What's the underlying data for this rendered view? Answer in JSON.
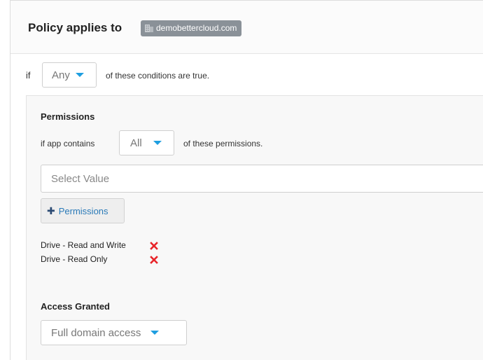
{
  "policy": {
    "title": "Policy applies to",
    "domain": "demobettercloud.com",
    "domain_icon": "building-icon"
  },
  "conditions": {
    "if_label": "if",
    "match": "Any",
    "suffix": "of these conditions are true."
  },
  "permissions_section": {
    "title": "Permissions",
    "prefix": "if app contains",
    "match": "All",
    "suffix": "of these permissions.",
    "select_placeholder": "Select Value",
    "add_button_label": "Permissions",
    "add_button_icon": "plus-icon",
    "items": [
      {
        "label": "Drive - Read and Write",
        "remove_icon": "remove-x-icon"
      },
      {
        "label": "Drive - Read Only",
        "remove_icon": "remove-x-icon"
      }
    ]
  },
  "access_section": {
    "title": "Access Granted",
    "value": "Full domain access"
  },
  "colors": {
    "accent": "#1e9ee0",
    "remove": "#e8252a",
    "badge": "#8a9198",
    "link": "#2a7ab8"
  }
}
